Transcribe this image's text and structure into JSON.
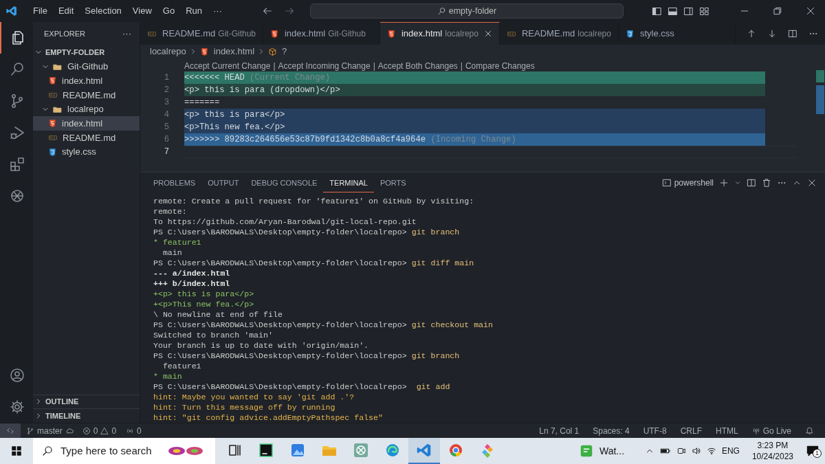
{
  "title_bar": {
    "menu": [
      "File",
      "Edit",
      "Selection",
      "View",
      "Go",
      "Run",
      "···"
    ],
    "search": "empty-folder"
  },
  "activity_bar": {
    "top": [
      {
        "kind": "files",
        "selected": true
      },
      {
        "kind": "search",
        "selected": false
      },
      {
        "kind": "source-control",
        "selected": false
      },
      {
        "kind": "run",
        "selected": false
      },
      {
        "kind": "extensions",
        "selected": false
      },
      {
        "kind": "knot",
        "selected": false
      }
    ],
    "bottom": [
      {
        "kind": "account"
      },
      {
        "kind": "settings"
      }
    ]
  },
  "sidebar": {
    "title": "EXPLORER",
    "more": "···",
    "tree": {
      "label": "EMPTY-FOLDER",
      "expanded": true,
      "children": [
        {
          "label": "Git-Github",
          "kind": "folder",
          "expanded": true,
          "children": [
            {
              "label": "index.html",
              "kind": "html",
              "selected": false
            },
            {
              "label": "README.md",
              "kind": "md",
              "selected": false
            }
          ]
        },
        {
          "label": "localrepo",
          "kind": "folder",
          "expanded": true,
          "children": [
            {
              "label": "index.html",
              "kind": "html",
              "selected": true
            },
            {
              "label": "README.md",
              "kind": "md",
              "selected": false
            },
            {
              "label": "style.css",
              "kind": "css",
              "selected": false
            }
          ]
        }
      ]
    },
    "sections": [
      {
        "label": "OUTLINE",
        "expanded": false
      },
      {
        "label": "TIMELINE",
        "expanded": false
      }
    ]
  },
  "tabs": [
    {
      "name": "README.md",
      "folder": "Git-Github",
      "kind": "md",
      "selected": false
    },
    {
      "name": "index.html",
      "folder": "Git-Github",
      "kind": "html",
      "selected": false
    },
    {
      "name": "index.html",
      "folder": "localrepo",
      "kind": "html",
      "selected": true
    },
    {
      "name": "README.md",
      "folder": "localrepo",
      "kind": "md",
      "selected": false
    },
    {
      "name": "style.css",
      "kind": "css",
      "selected": false
    }
  ],
  "breadcrumb": [
    {
      "label": "localrepo",
      "kind": "folder"
    },
    {
      "label": "index.html",
      "kind": "html"
    },
    {
      "label": "?",
      "kind": "symbol"
    }
  ],
  "codelens": {
    "actions": [
      "Accept Current Change",
      "Accept Incoming Change",
      "Accept Both Changes",
      "Compare Changes"
    ],
    "separator": "|"
  },
  "lines": [
    {
      "number": "1",
      "kind": "current-marker",
      "text": "<<<<<<< HEAD",
      "note": "(Current Change)"
    },
    {
      "number": "2",
      "kind": "current",
      "text": "<p> this is para (dropdown)</p>"
    },
    {
      "number": "3",
      "kind": "plain",
      "text": "======="
    },
    {
      "number": "4",
      "kind": "incoming",
      "text": "<p> this is para</p>"
    },
    {
      "number": "5",
      "kind": "incoming",
      "text": "<p>This new fea.</p>"
    },
    {
      "number": "6",
      "kind": "incoming-marker",
      "text": ">>>>>>> 89283c264656e53c87b9fd1342c8b0a8cf4a964e",
      "note": "(Incoming Change)"
    },
    {
      "number": "7",
      "kind": "plain"
    }
  ],
  "panel": {
    "tabs": [
      {
        "label": "PROBLEMS",
        "selected": false
      },
      {
        "label": "OUTPUT",
        "selected": false
      },
      {
        "label": "DEBUG CONSOLE",
        "selected": false
      },
      {
        "label": "TERMINAL",
        "selected": true
      },
      {
        "label": "PORTS",
        "selected": false
      }
    ],
    "terminal_name": "powershell",
    "terminal": [
      {
        "kind": "plain",
        "text": "remote: Create a pull request for 'feature1' on GitHub by visiting:"
      },
      {
        "kind": "plain",
        "text": "remote:"
      },
      {
        "kind": "plain",
        "text": "To https://github.com/Aryan-Barodwal/git-local-repo.git"
      },
      {
        "kind": "prompt",
        "text": "PS C:\\Users\\BARODWALS\\Desktop\\empty-folder\\localrepo>",
        "command": "git branch"
      },
      {
        "kind": "green",
        "text": "* feature1"
      },
      {
        "kind": "plain",
        "text": "  main"
      },
      {
        "kind": "prompt",
        "text": "PS C:\\Users\\BARODWALS\\Desktop\\empty-folder\\localrepo>",
        "command": "git diff main"
      },
      {
        "kind": "bold",
        "text": "--- a/index.html"
      },
      {
        "kind": "bold",
        "text": "+++ b/index.html"
      },
      {
        "kind": "green",
        "text": "+<p> this is para</p>"
      },
      {
        "kind": "green",
        "text": "+<p>This new fea.</p>"
      },
      {
        "kind": "plain",
        "text": "\\ No newline at end of file"
      },
      {
        "kind": "prompt",
        "text": "PS C:\\Users\\BARODWALS\\Desktop\\empty-folder\\localrepo>",
        "command": "git checkout main"
      },
      {
        "kind": "plain",
        "text": "Switched to branch 'main'"
      },
      {
        "kind": "plain",
        "text": "Your branch is up to date with 'origin/main'."
      },
      {
        "kind": "prompt",
        "text": "PS C:\\Users\\BARODWALS\\Desktop\\empty-folder\\localrepo>",
        "command": "git branch"
      },
      {
        "kind": "plain",
        "text": "  feature1"
      },
      {
        "kind": "green",
        "text": "* main"
      },
      {
        "kind": "prompt",
        "text": "PS C:\\Users\\BARODWALS\\Desktop\\empty-folder\\localrepo>",
        "command": " git add"
      },
      {
        "kind": "hint",
        "text": "hint: Maybe you wanted to say 'git add .'?"
      },
      {
        "kind": "hint",
        "text": "hint: Turn this message off by running"
      },
      {
        "kind": "hint",
        "text": "hint: \"git config advice.addEmptyPathspec false\""
      }
    ]
  },
  "status_bar": {
    "branch": "master",
    "errors": "0",
    "warnings": "0",
    "ports": "0",
    "right": [
      "Ln 7, Col 1",
      "Spaces: 4",
      "UTF-8",
      "CRLF",
      "HTML"
    ],
    "go_live": "Go Live"
  },
  "taskbar": {
    "search_placeholder": "Type here to search",
    "apps": [
      {
        "kind": "task-view",
        "selected": false
      },
      {
        "kind": "pycharm",
        "selected": false
      },
      {
        "kind": "photos",
        "selected": false
      },
      {
        "kind": "folder",
        "selected": false
      },
      {
        "kind": "knot",
        "selected": false
      },
      {
        "kind": "edge",
        "selected": false
      },
      {
        "kind": "vscode",
        "selected": true
      },
      {
        "kind": "chrome",
        "selected": false
      },
      {
        "kind": "tiles",
        "selected": false
      }
    ],
    "whatsapp": "Wat...",
    "language": "ENG",
    "time": "3:23 PM",
    "date": "10/24/2023",
    "notifications": "1"
  }
}
